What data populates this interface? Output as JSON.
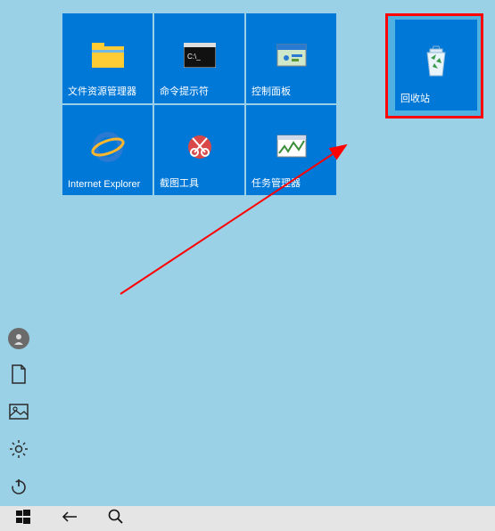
{
  "tiles": [
    {
      "label": "文件资源管理器",
      "icon": "folder"
    },
    {
      "label": "命令提示符",
      "icon": "cmd"
    },
    {
      "label": "控制面板",
      "icon": "control-panel"
    },
    {
      "label": "Internet Explorer",
      "icon": "ie"
    },
    {
      "label": "截图工具",
      "icon": "snip"
    },
    {
      "label": "任务管理器",
      "icon": "taskmgr"
    }
  ],
  "highlighted_tile": {
    "label": "回收站",
    "icon": "recycle-bin"
  },
  "sidebar": {
    "user": "user",
    "documents": "documents",
    "pictures": "pictures",
    "settings": "settings",
    "power": "power"
  },
  "taskbar": {
    "start": "start",
    "back": "back",
    "search": "search"
  },
  "annotation": {
    "highlight_color": "#ff0000",
    "arrow_color": "#ff0000"
  }
}
